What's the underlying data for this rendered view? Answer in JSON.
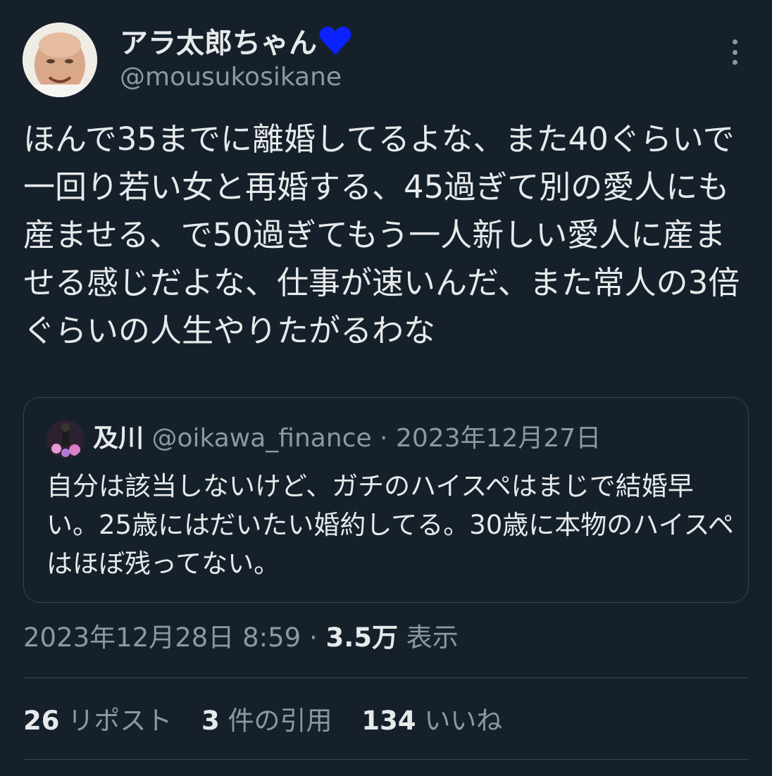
{
  "author": {
    "display_name": "アラ太郎ちゃん",
    "handle": "@mousukosikane",
    "heart_color": "#0a22ff"
  },
  "tweet": {
    "text": "ほんで35までに離婚してるよな、また40ぐらいで一回り若い女と再婚する、45過ぎて別の愛人にも産ませる、で50過ぎてもう一人新しい愛人に産ませる感じだよな、仕事が速いんだ、また常人の3倍ぐらいの人生やりたがるわな"
  },
  "quote": {
    "name": "及川",
    "handle": "@oikawa_finance",
    "separator": "·",
    "date": "2023年12月27日",
    "text": "自分は該当しないけど、ガチのハイスペはまじで結婚早い。25歳にはだいたい婚約してる。30歳に本物のハイスペはほぼ残ってない。"
  },
  "meta": {
    "timestamp": "2023年12月28日 8:59",
    "separator": "·",
    "views_count": "3.5万",
    "views_label": "表示"
  },
  "stats": {
    "reposts_count": "26",
    "reposts_label": "リポスト",
    "quotes_count": "3",
    "quotes_label": "件の引用",
    "likes_count": "134",
    "likes_label": "いいね"
  },
  "icons": {
    "more": "more-options-icon",
    "heart": "heart-emoji-icon"
  }
}
